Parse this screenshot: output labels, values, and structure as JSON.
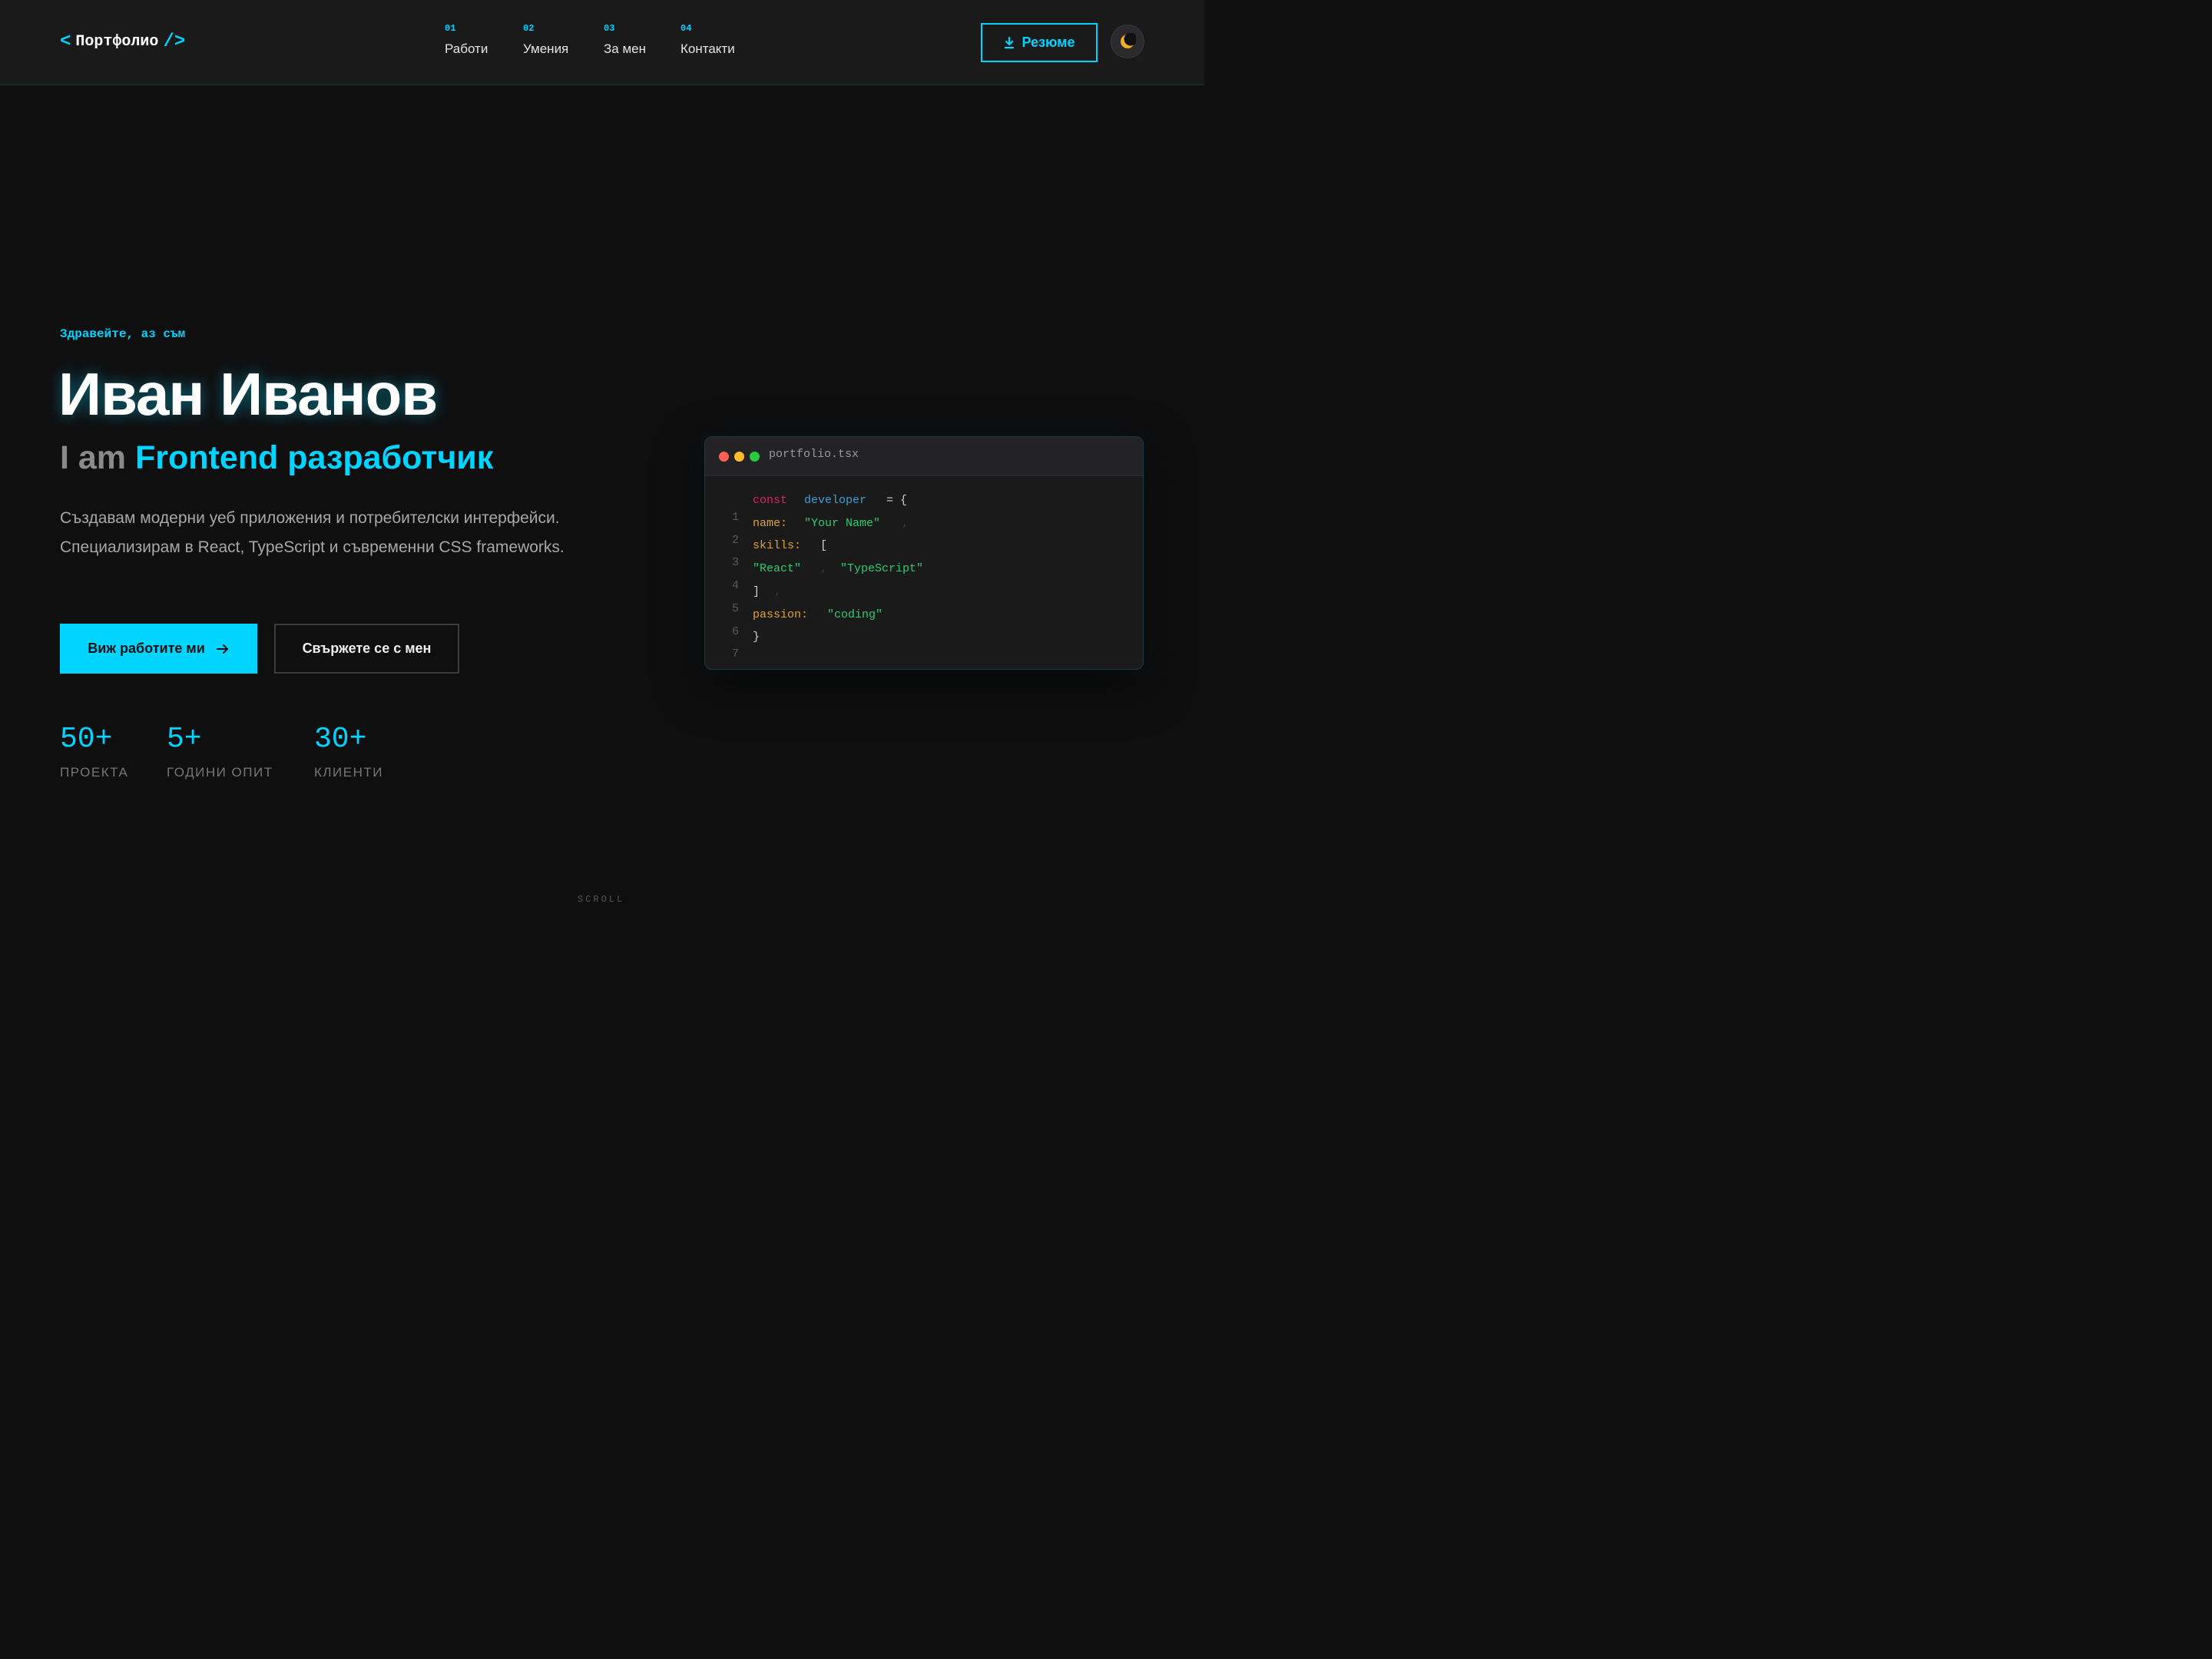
{
  "header": {
    "logo": {
      "open": "<",
      "text": "Портфолио",
      "close": "/>"
    },
    "nav": [
      {
        "num": "01",
        "label": "Работи"
      },
      {
        "num": "02",
        "label": "Умения"
      },
      {
        "num": "03",
        "label": "За мен"
      },
      {
        "num": "04",
        "label": "Контакти"
      }
    ],
    "resume_label": "Резюме"
  },
  "hero": {
    "greeting": "Здравейте, аз съм",
    "name": "Иван Иванов",
    "role_prefix": "I am",
    "role_highlight": "Frontend разработчик",
    "description": "Създавам модерни уеб приложения и потребителски интерфейси. Специализирам в React, TypeScript и съвременни CSS frameworks.",
    "primary_cta": "Виж работите ми",
    "secondary_cta": "Свържете се с мен",
    "stats": [
      {
        "value": "50+",
        "label": "ПРОЕКТА"
      },
      {
        "value": "5+",
        "label": "ГОДИНИ ОПИТ"
      },
      {
        "value": "30+",
        "label": "КЛИЕНТИ"
      }
    ]
  },
  "code_card": {
    "filename": "portfolio.tsx",
    "lines": [
      {
        "num": "1",
        "t1": "const",
        "t2": "developer",
        "t3": "= {"
      },
      {
        "num": "2",
        "t1": "name:",
        "t2": "\"Your Name\"",
        "t3": ","
      },
      {
        "num": "3",
        "t1": "skills:",
        "t2": "["
      },
      {
        "num": "4",
        "t1": "\"React\"",
        "t2": ",",
        "t3": "\"TypeScript\""
      },
      {
        "num": "5",
        "t1": "]",
        "t2": ","
      },
      {
        "num": "6",
        "t1": "passion:",
        "t2": "\"coding\""
      },
      {
        "num": "7",
        "t1": "}"
      }
    ]
  },
  "scroll_label": "SCROLL",
  "colors": {
    "accent": "#00d4ff",
    "background": "#0f0f10",
    "header": "#1a1a1b"
  }
}
